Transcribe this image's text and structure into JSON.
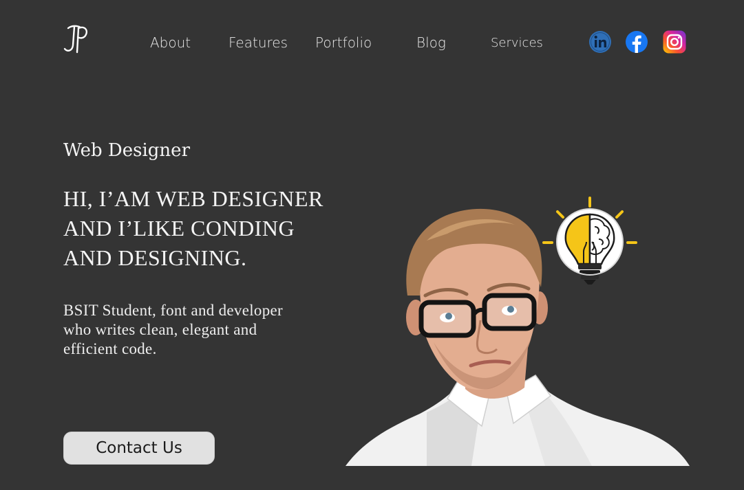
{
  "header": {
    "logo_text": "JP",
    "nav": [
      {
        "label": "About"
      },
      {
        "label": "Features"
      },
      {
        "label": "Portfolio"
      },
      {
        "label": "Blog"
      },
      {
        "label": "Services"
      }
    ],
    "social_icons": [
      "linkedin-icon",
      "facebook-icon",
      "instagram-icon"
    ]
  },
  "hero": {
    "eyebrow": "Web Designer",
    "headline_lines": [
      "HI, I’AM WEB DESIGNER",
      "AND I’LIKE CONDING",
      "AND DESIGNING."
    ],
    "description_lines": [
      "BSIT Student, font and developer",
      "who writes clean, elegant and",
      "efficient code."
    ],
    "cta_label": "Contact Us",
    "images": [
      "man-with-glasses-photo",
      "lightbulb-brain-icon"
    ]
  },
  "colors": {
    "background": "#343434",
    "text": "#f2f2f2",
    "button_bg": "#e1e1e1",
    "linkedin": "#2f6fb7",
    "facebook": "#1877f2",
    "bulb_yellow": "#f5c518"
  }
}
